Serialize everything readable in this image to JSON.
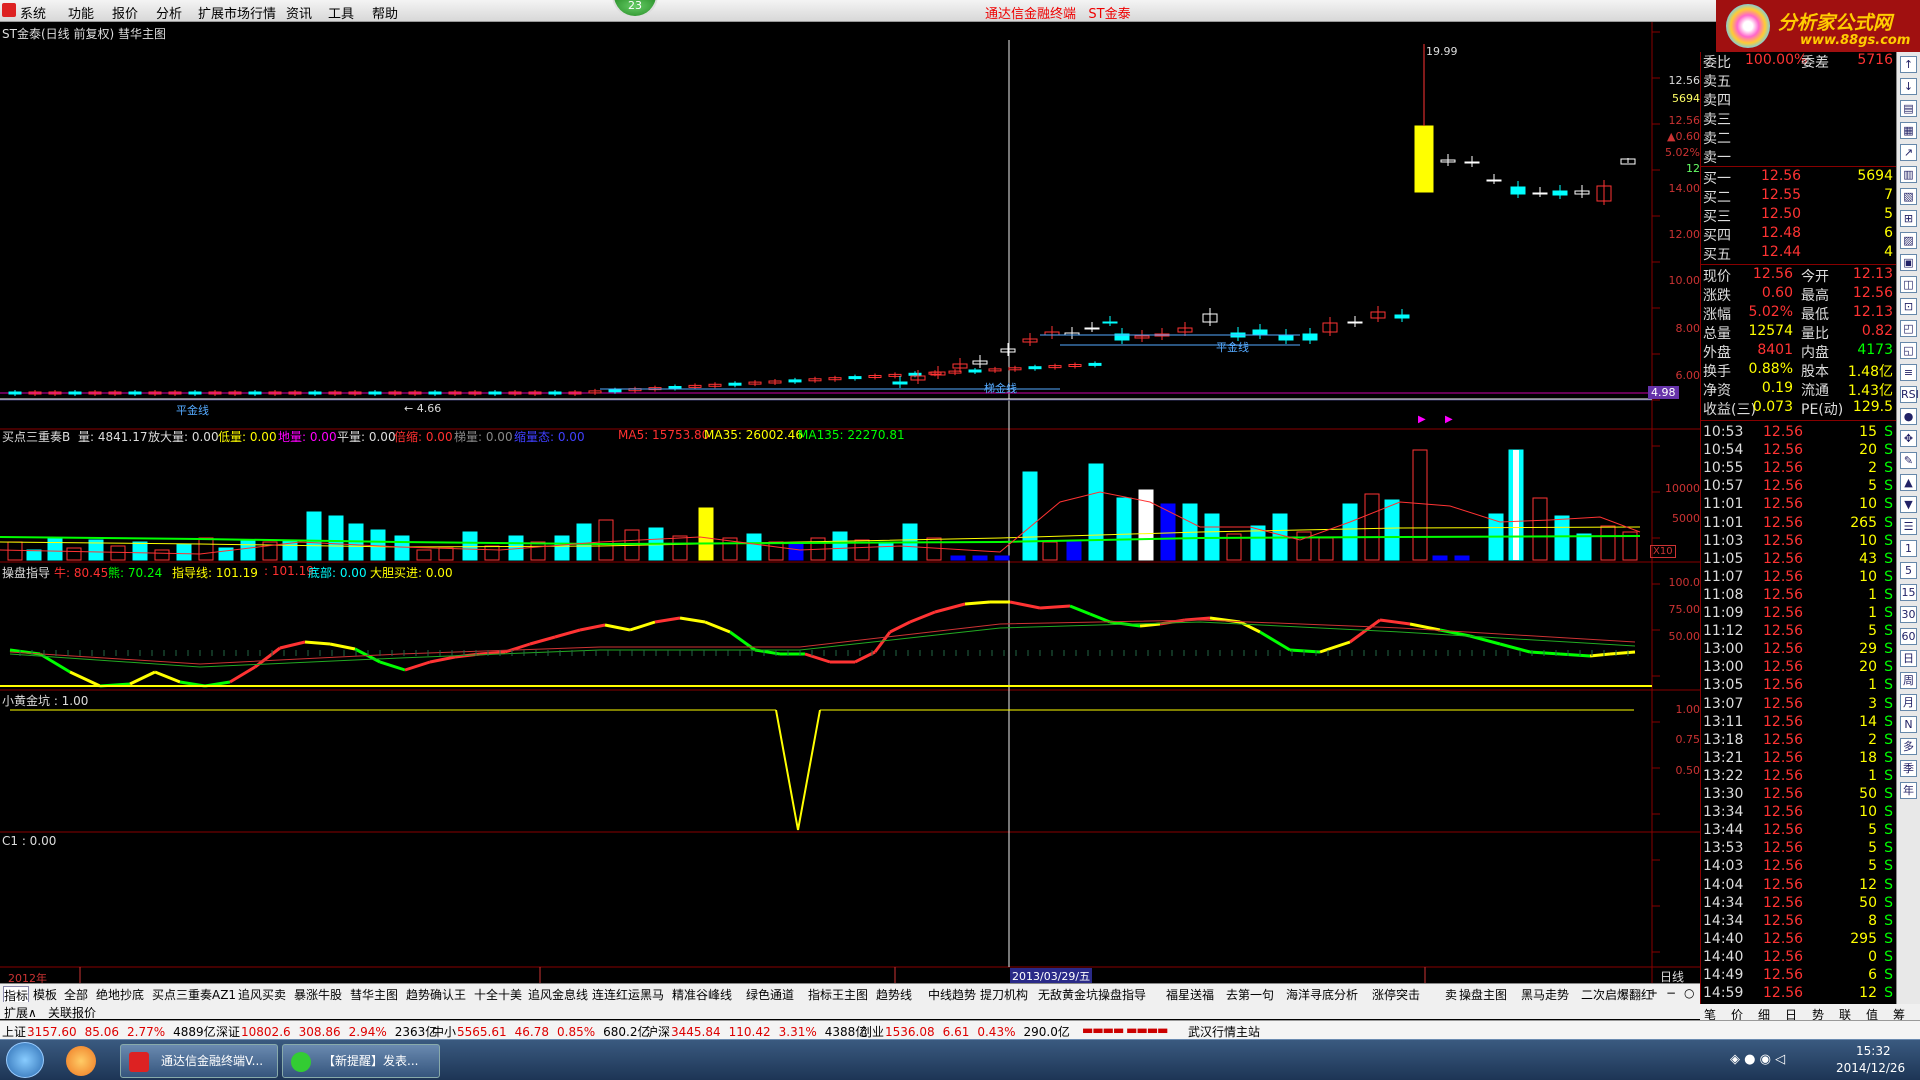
{
  "menu": {
    "items": [
      "系统",
      "功能",
      "报价",
      "分析",
      "扩展市场行情",
      "资讯",
      "工具",
      "帮助"
    ],
    "title_app": "通达信金融终端",
    "title_stock": "ST金泰",
    "badge": "23"
  },
  "logo": {
    "line1": "分析家公式网",
    "line2": "www.88gs.com"
  },
  "chart": {
    "header": "ST金泰(日线 前复权) 彗华主图",
    "peak_label": "19.99",
    "low_label": "4.66",
    "last_price_box": "4.98",
    "line_label_1": "平金线",
    "line_label_2": "梯金线",
    "line_label_3": "平金线",
    "price_axis": [
      "14.00",
      "12.00",
      "10.00",
      "8.00",
      "6.00"
    ],
    "quote_axis": [
      "12.56",
      "5694",
      "12.56",
      "▲0.60",
      "5.02%",
      "12"
    ],
    "vol_header": {
      "name": "买点三重奏B",
      "items": [
        {
          "text": "量: 4841.17",
          "color": "#ddd"
        },
        {
          "text": "放大量: 0.00",
          "color": "#ddd"
        },
        {
          "text": "低量: 0.00",
          "color": "#ffff00"
        },
        {
          "text": "地量: 0.00",
          "color": "#ff00ff"
        },
        {
          "text": "平量: 0.00",
          "color": "#ddd"
        },
        {
          "text": "倍缩: 0.00",
          "color": "#ff3030"
        },
        {
          "text": "梯量: 0.00",
          "color": "#888"
        },
        {
          "text": "缩量态: 0.00",
          "color": "#4040ff"
        },
        {
          "text": "MA5: 15753.80",
          "color": "#ff3030"
        },
        {
          "text": "MA35: 26002.46",
          "color": "#ffff00"
        },
        {
          "text": "MA135: 22270.81",
          "color": "#00ff00"
        }
      ]
    },
    "vol_axis": [
      "10000",
      "5000"
    ],
    "vol_unit": "X10",
    "ind_header": {
      "name": "操盘指导",
      "items": [
        {
          "text": "牛: 80.45",
          "color": "#ff3030"
        },
        {
          "text": "熊: 70.24",
          "color": "#00ff00"
        },
        {
          "text": "指导线: 101.19",
          "color": "#ffff00"
        },
        {
          "text": ": 101.19",
          "color": "#ff3030"
        },
        {
          "text": "底部: 0.00",
          "color": "#00ffff"
        },
        {
          "text": "大胆买进: 0.00",
          "color": "#ffff00"
        }
      ]
    },
    "ind_axis": [
      "100.0",
      "75.00",
      "50.00"
    ],
    "gold_header": "小黄金坑 : 1.00",
    "gold_axis": [
      "1.00",
      "0.75",
      "0.50"
    ],
    "c1_header": "C1 : 0.00",
    "date_cursor": "2013/03/29/五",
    "year_label": "2012年",
    "period": "日线"
  },
  "quote_panel": {
    "top": [
      {
        "label": "委比",
        "val": "100.00%",
        "label2": "委差",
        "val2": "5716"
      }
    ],
    "asks": [
      {
        "label": "卖五"
      },
      {
        "label": "卖四"
      },
      {
        "label": "卖三"
      },
      {
        "label": "卖二"
      },
      {
        "label": "卖一"
      }
    ],
    "bids": [
      {
        "label": "买一",
        "price": "12.56",
        "vol": "5694"
      },
      {
        "label": "买二",
        "price": "12.55",
        "vol": "7"
      },
      {
        "label": "买三",
        "price": "12.50",
        "vol": "5"
      },
      {
        "label": "买四",
        "price": "12.48",
        "vol": "6"
      },
      {
        "label": "买五",
        "price": "12.44",
        "vol": "4"
      }
    ],
    "stats": [
      {
        "l1": "现价",
        "v1": "12.56",
        "l2": "今开",
        "v2": "12.13"
      },
      {
        "l1": "涨跌",
        "v1": "0.60",
        "l2": "最高",
        "v2": "12.56"
      },
      {
        "l1": "涨幅",
        "v1": "5.02%",
        "l2": "最低",
        "v2": "12.13"
      },
      {
        "l1": "总量",
        "v1": "12574",
        "l2": "量比",
        "v2": "0.82"
      },
      {
        "l1": "外盘",
        "v1": "8401",
        "l2": "内盘",
        "v2": "4173"
      },
      {
        "l1": "换手",
        "v1": "0.88%",
        "l2": "股本",
        "v2": "1.48亿"
      },
      {
        "l1": "净资",
        "v1": "0.19",
        "l2": "流通",
        "v2": "1.43亿"
      },
      {
        "l1": "收益(三)",
        "v1": "0.073",
        "l2": "PE(动)",
        "v2": "129.5"
      }
    ],
    "ticks": [
      [
        "10:53",
        "12.56",
        "15"
      ],
      [
        "10:54",
        "12.56",
        "20"
      ],
      [
        "10:55",
        "12.56",
        "2"
      ],
      [
        "10:57",
        "12.56",
        "5"
      ],
      [
        "11:01",
        "12.56",
        "10"
      ],
      [
        "11:01",
        "12.56",
        "265"
      ],
      [
        "11:03",
        "12.56",
        "10"
      ],
      [
        "11:05",
        "12.56",
        "43"
      ],
      [
        "11:07",
        "12.56",
        "10"
      ],
      [
        "11:08",
        "12.56",
        "1"
      ],
      [
        "11:09",
        "12.56",
        "1"
      ],
      [
        "11:12",
        "12.56",
        "5"
      ],
      [
        "13:00",
        "12.56",
        "29"
      ],
      [
        "13:00",
        "12.56",
        "20"
      ],
      [
        "13:05",
        "12.56",
        "1"
      ],
      [
        "13:07",
        "12.56",
        "3"
      ],
      [
        "13:11",
        "12.56",
        "14"
      ],
      [
        "13:18",
        "12.56",
        "2"
      ],
      [
        "13:21",
        "12.56",
        "18"
      ],
      [
        "13:22",
        "12.56",
        "1"
      ],
      [
        "13:30",
        "12.56",
        "50"
      ],
      [
        "13:34",
        "12.56",
        "10"
      ],
      [
        "13:44",
        "12.56",
        "5"
      ],
      [
        "13:53",
        "12.56",
        "5"
      ],
      [
        "14:03",
        "12.56",
        "5"
      ],
      [
        "14:04",
        "12.56",
        "12"
      ],
      [
        "14:34",
        "12.56",
        "50"
      ],
      [
        "14:34",
        "12.56",
        "8"
      ],
      [
        "14:40",
        "12.56",
        "295"
      ],
      [
        "14:40",
        "12.56",
        "0"
      ],
      [
        "14:49",
        "12.56",
        "6"
      ],
      [
        "14:59",
        "12.56",
        "12"
      ]
    ],
    "tick_flag": "S"
  },
  "right_icons": [
    "↑",
    "↓",
    "▤",
    "▦",
    "↗",
    "▥",
    "▧",
    "⊞",
    "▨",
    "▣",
    "◫",
    "⊡",
    "◰",
    "◱",
    "≡",
    "RSI",
    "●",
    "✥",
    "✎",
    "▲",
    "▼",
    "☰",
    "1",
    "5",
    "15",
    "30",
    "60",
    "日",
    "周",
    "月",
    "N",
    "多",
    "季",
    "年"
  ],
  "tabs": [
    "指标",
    "模板",
    "全部",
    "绝地抄底",
    "买点三重奏AZ1",
    "追风买卖",
    "暴涨牛股",
    "彗华主图",
    "趋势确认王",
    "十全十美",
    "追风金息线",
    "连连红运黑马",
    "精准谷峰线",
    "绿色通道",
    "指标王主图",
    "趋势线",
    "中线趋势",
    "提刀机构",
    "无敌黄金坑",
    "操盘指导",
    "福星送福",
    "去第一句",
    "海洋寻底分析",
    "涨停突击",
    "卖",
    "操盘主图",
    "黑马走势",
    "二次启爆翻红"
  ],
  "tabs2": [
    "扩展∧",
    "关联报价"
  ],
  "right_tabs": [
    "笔",
    "价",
    "细",
    "日",
    "势",
    "联",
    "值",
    "筹"
  ],
  "status": [
    {
      "label": "上证",
      "vals": [
        {
          "t": "3157.60",
          "c": "#d00"
        },
        {
          "t": "85.06",
          "c": "#d00"
        },
        {
          "t": "2.77%",
          "c": "#d00"
        },
        {
          "t": "4889亿",
          "c": "#000"
        }
      ]
    },
    {
      "label": "深证",
      "vals": [
        {
          "t": "10802.6",
          "c": "#d00"
        },
        {
          "t": "308.86",
          "c": "#d00"
        },
        {
          "t": "2.94%",
          "c": "#d00"
        },
        {
          "t": "2363亿",
          "c": "#000"
        }
      ]
    },
    {
      "label": "中小",
      "vals": [
        {
          "t": "5565.61",
          "c": "#d00"
        },
        {
          "t": "46.78",
          "c": "#d00"
        },
        {
          "t": "0.85%",
          "c": "#d00"
        },
        {
          "t": "680.2亿",
          "c": "#000"
        }
      ]
    },
    {
      "label": "沪深",
      "vals": [
        {
          "t": "3445.84",
          "c": "#d00"
        },
        {
          "t": "110.42",
          "c": "#d00"
        },
        {
          "t": "3.31%",
          "c": "#d00"
        },
        {
          "t": "4388亿",
          "c": "#000"
        }
      ]
    },
    {
      "label": "创业",
      "vals": [
        {
          "t": "1536.08",
          "c": "#d00"
        },
        {
          "t": "6.61",
          "c": "#d00"
        },
        {
          "t": "0.43%",
          "c": "#d00"
        },
        {
          "t": "290.0亿",
          "c": "#000"
        }
      ]
    }
  ],
  "status_site": "武汉行情主站",
  "taskbar": {
    "task1": "通达信金融终端V...",
    "task2": "【新提醒】发表...",
    "time": "15:32",
    "date": "2014/12/26"
  }
}
